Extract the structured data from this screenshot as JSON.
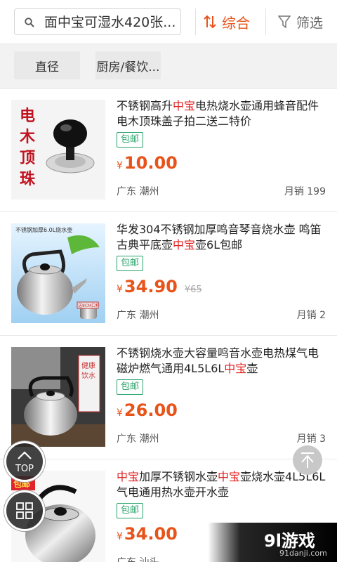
{
  "search": {
    "query": "面中宝可湿水420张..."
  },
  "sort": {
    "label": "综合"
  },
  "filter": {
    "label": "筛选"
  },
  "chips": [
    "直径",
    "厨房/餐饮..."
  ],
  "products": [
    {
      "title_parts": [
        {
          "t": "不锈钢高升",
          "hl": false
        },
        {
          "t": "中宝",
          "hl": true
        },
        {
          "t": "电热烧水壶通用蜂音配件电木顶珠盖子拍二送二特价",
          "hl": false
        }
      ],
      "badge": "包邮",
      "yen": "¥",
      "price": "10.00",
      "old_price": "",
      "location": "广东 潮州",
      "sales": "月销 199",
      "img_text": "电木顶珠套"
    },
    {
      "title_parts": [
        {
          "t": "华发304不锈钢加厚鸣音琴音烧水壶 鸣笛古典平底壶",
          "hl": false
        },
        {
          "t": "中宝",
          "hl": true
        },
        {
          "t": "壶6L包邮",
          "hl": false
        }
      ],
      "badge": "包邮",
      "yen": "¥",
      "price": "34.90",
      "old_price": "¥65",
      "location": "广东 潮州",
      "sales": "月销 2",
      "img_text": "不锈钢加厚6.0L烧水壶"
    },
    {
      "title_parts": [
        {
          "t": "不锈钢烧水壶大容量鸣音水壶电热煤气电磁炉燃气通用4L5L6L",
          "hl": false
        },
        {
          "t": "中宝",
          "hl": true
        },
        {
          "t": "壶",
          "hl": false
        }
      ],
      "badge": "包邮",
      "yen": "¥",
      "price": "26.00",
      "old_price": "",
      "location": "广东 潮州",
      "sales": "月销 3",
      "img_text": "健康饮水"
    },
    {
      "title_parts": [
        {
          "t": "中宝",
          "hl": true
        },
        {
          "t": "加厚不锈钢水壶",
          "hl": false
        },
        {
          "t": "中宝",
          "hl": true
        },
        {
          "t": "壶烧水壶4L5L6L气电通用热水壶开水壶",
          "hl": false
        }
      ],
      "badge": "包邮",
      "yen": "¥",
      "price": "34.00",
      "old_price": "",
      "location": "广东 汕头",
      "sales": "",
      "img_text": "包邮"
    }
  ],
  "fab": {
    "top_label": "TOP"
  },
  "watermark": {
    "brand": "9l游戏",
    "site": "91danji.com"
  }
}
